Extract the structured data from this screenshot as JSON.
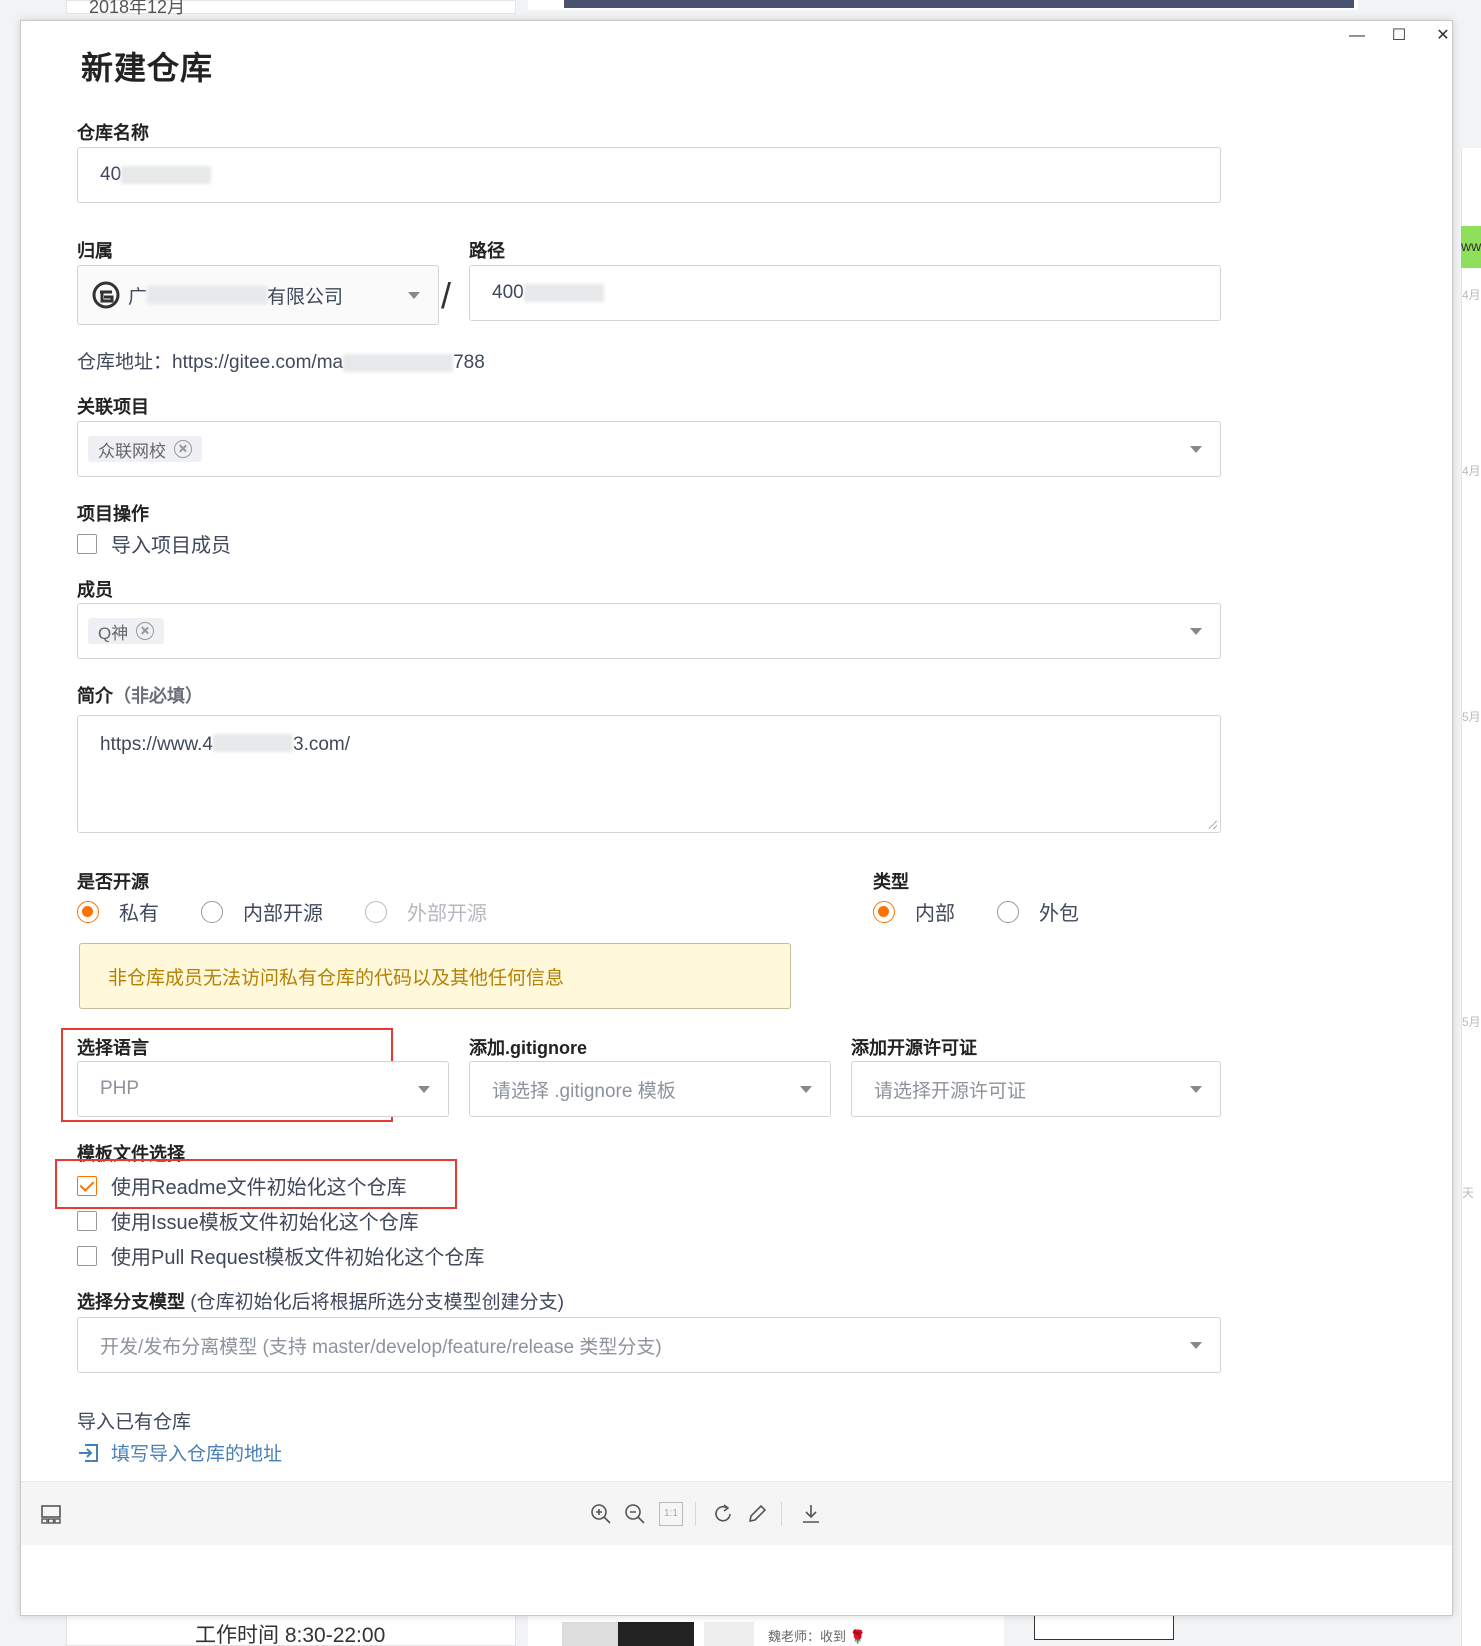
{
  "background": {
    "left_card_top_text": "2018年12月",
    "green_tab_text": "ww",
    "side_labels": [
      "4月",
      "4月",
      "5月",
      "5月",
      "天"
    ],
    "bottom_left_text": "工作时间 8:30-22:00",
    "bottom_mid_text": "魏老师：收到 🌹"
  },
  "window": {
    "minimize": "—",
    "maximize": "☐",
    "close": "✕"
  },
  "form": {
    "title": "新建仓库",
    "repo_name": {
      "label": "仓库名称",
      "value": "40"
    },
    "owner": {
      "label": "归属",
      "value_prefix": "广",
      "value_suffix": "有限公司"
    },
    "slash": "/",
    "path": {
      "label": "路径",
      "value": "400"
    },
    "repo_url": {
      "prefix": "仓库地址：https://gitee.com/",
      "visible_start": "ma",
      "suffix": "788"
    },
    "project": {
      "label": "关联项目",
      "tag": "众联网校"
    },
    "project_ops": {
      "label": "项目操作",
      "import_members": "导入项目成员"
    },
    "members": {
      "label": "成员",
      "tag": "Q神"
    },
    "intro": {
      "label": "简介",
      "optional": "（非必填）",
      "value_prefix": "https://www.4",
      "value_suffix": "3.com/"
    },
    "open_source": {
      "label": "是否开源",
      "options": [
        {
          "label": "私有",
          "checked": true,
          "disabled": false
        },
        {
          "label": "内部开源",
          "checked": false,
          "disabled": false
        },
        {
          "label": "外部开源",
          "checked": false,
          "disabled": true
        }
      ]
    },
    "type": {
      "label": "类型",
      "options": [
        {
          "label": "内部",
          "checked": true
        },
        {
          "label": "外包",
          "checked": false
        }
      ]
    },
    "notice": "非仓库成员无法访问私有仓库的代码以及其他任何信息",
    "language": {
      "label": "选择语言",
      "value": "PHP"
    },
    "gitignore": {
      "label": "添加.gitignore",
      "placeholder": "请选择 .gitignore 模板"
    },
    "license": {
      "label": "添加开源许可证",
      "placeholder": "请选择开源许可证"
    },
    "templates": {
      "label": "模板文件选择",
      "options": [
        {
          "label": "使用Readme文件初始化这个仓库",
          "checked": true
        },
        {
          "label": "使用Issue模板文件初始化这个仓库",
          "checked": false
        },
        {
          "label": "使用Pull Request模板文件初始化这个仓库",
          "checked": false
        }
      ]
    },
    "branch_model": {
      "label": "选择分支模型",
      "hint": " (仓库初始化后将根据所选分支模型创建分支)",
      "value": "开发/发布分离模型 (支持 master/develop/feature/release 类型分支)"
    },
    "import_repo": {
      "label": "导入已有仓库",
      "link": "填写导入仓库的地址"
    }
  },
  "toolbar": {
    "icons": [
      "thumbnail-icon",
      "zoom-in-icon",
      "zoom-out-icon",
      "actual-size-icon",
      "rotate-icon",
      "edit-icon",
      "download-icon"
    ],
    "actual_size_text": "1:1"
  },
  "colors": {
    "accent": "#fe7300",
    "highlight_box": "#e53935",
    "notice_bg": "#fff8db",
    "notice_text": "#b58105",
    "link": "#4a7fb5"
  }
}
